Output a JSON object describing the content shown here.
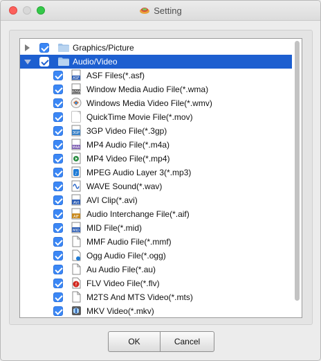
{
  "window": {
    "title": "Setting"
  },
  "tree": [
    {
      "label": "Graphics/Picture",
      "level": 0,
      "expanded": false,
      "checked": true,
      "selected": false,
      "icon": "folder-icon"
    },
    {
      "label": "Audio/Video",
      "level": 0,
      "expanded": true,
      "checked": true,
      "selected": true,
      "icon": "folder-icon"
    },
    {
      "label": "ASF Files(*.asf)",
      "level": 1,
      "checked": true,
      "icon": "asf-file-icon"
    },
    {
      "label": "Window Media Audio File(*.wma)",
      "level": 1,
      "checked": true,
      "icon": "wma-file-icon"
    },
    {
      "label": "Windows Media Video File(*.wmv)",
      "level": 1,
      "checked": true,
      "icon": "wmv-file-icon"
    },
    {
      "label": "QuickTime Movie File(*.mov)",
      "level": 1,
      "checked": true,
      "icon": "mov-file-icon"
    },
    {
      "label": "3GP Video File(*.3gp)",
      "level": 1,
      "checked": true,
      "icon": "3gp-file-icon"
    },
    {
      "label": "MP4 Audio File(*.m4a)",
      "level": 1,
      "checked": true,
      "icon": "m4a-file-icon"
    },
    {
      "label": "MP4 Video File(*.mp4)",
      "level": 1,
      "checked": true,
      "icon": "mp4-file-icon"
    },
    {
      "label": "MPEG Audio Layer 3(*.mp3)",
      "level": 1,
      "checked": true,
      "icon": "mp3-file-icon"
    },
    {
      "label": "WAVE Sound(*.wav)",
      "level": 1,
      "checked": true,
      "icon": "wav-file-icon"
    },
    {
      "label": "AVI Clip(*.avi)",
      "level": 1,
      "checked": true,
      "icon": "avi-file-icon"
    },
    {
      "label": "Audio Interchange File(*.aif)",
      "level": 1,
      "checked": true,
      "icon": "aif-file-icon"
    },
    {
      "label": "MID File(*.mid)",
      "level": 1,
      "checked": true,
      "icon": "mid-file-icon"
    },
    {
      "label": "MMF Audio File(*.mmf)",
      "level": 1,
      "checked": true,
      "icon": "mmf-file-icon"
    },
    {
      "label": "Ogg Audio File(*.ogg)",
      "level": 1,
      "checked": true,
      "icon": "ogg-file-icon"
    },
    {
      "label": "Au Audio File(*.au)",
      "level": 1,
      "checked": true,
      "icon": "au-file-icon"
    },
    {
      "label": "FLV Video File(*.flv)",
      "level": 1,
      "checked": true,
      "icon": "flv-file-icon"
    },
    {
      "label": "M2TS And MTS Video(*.mts)",
      "level": 1,
      "checked": true,
      "icon": "mts-file-icon"
    },
    {
      "label": "MKV Video(*.mkv)",
      "level": 1,
      "checked": true,
      "icon": "mkv-file-icon"
    }
  ],
  "buttons": {
    "ok": "OK",
    "cancel": "Cancel"
  },
  "colors": {
    "selection": "#1d5fd0",
    "checkbox": "#3b87f5",
    "close": "#fc605b",
    "maximize": "#34c84a",
    "folder": "#9fc2e8"
  }
}
